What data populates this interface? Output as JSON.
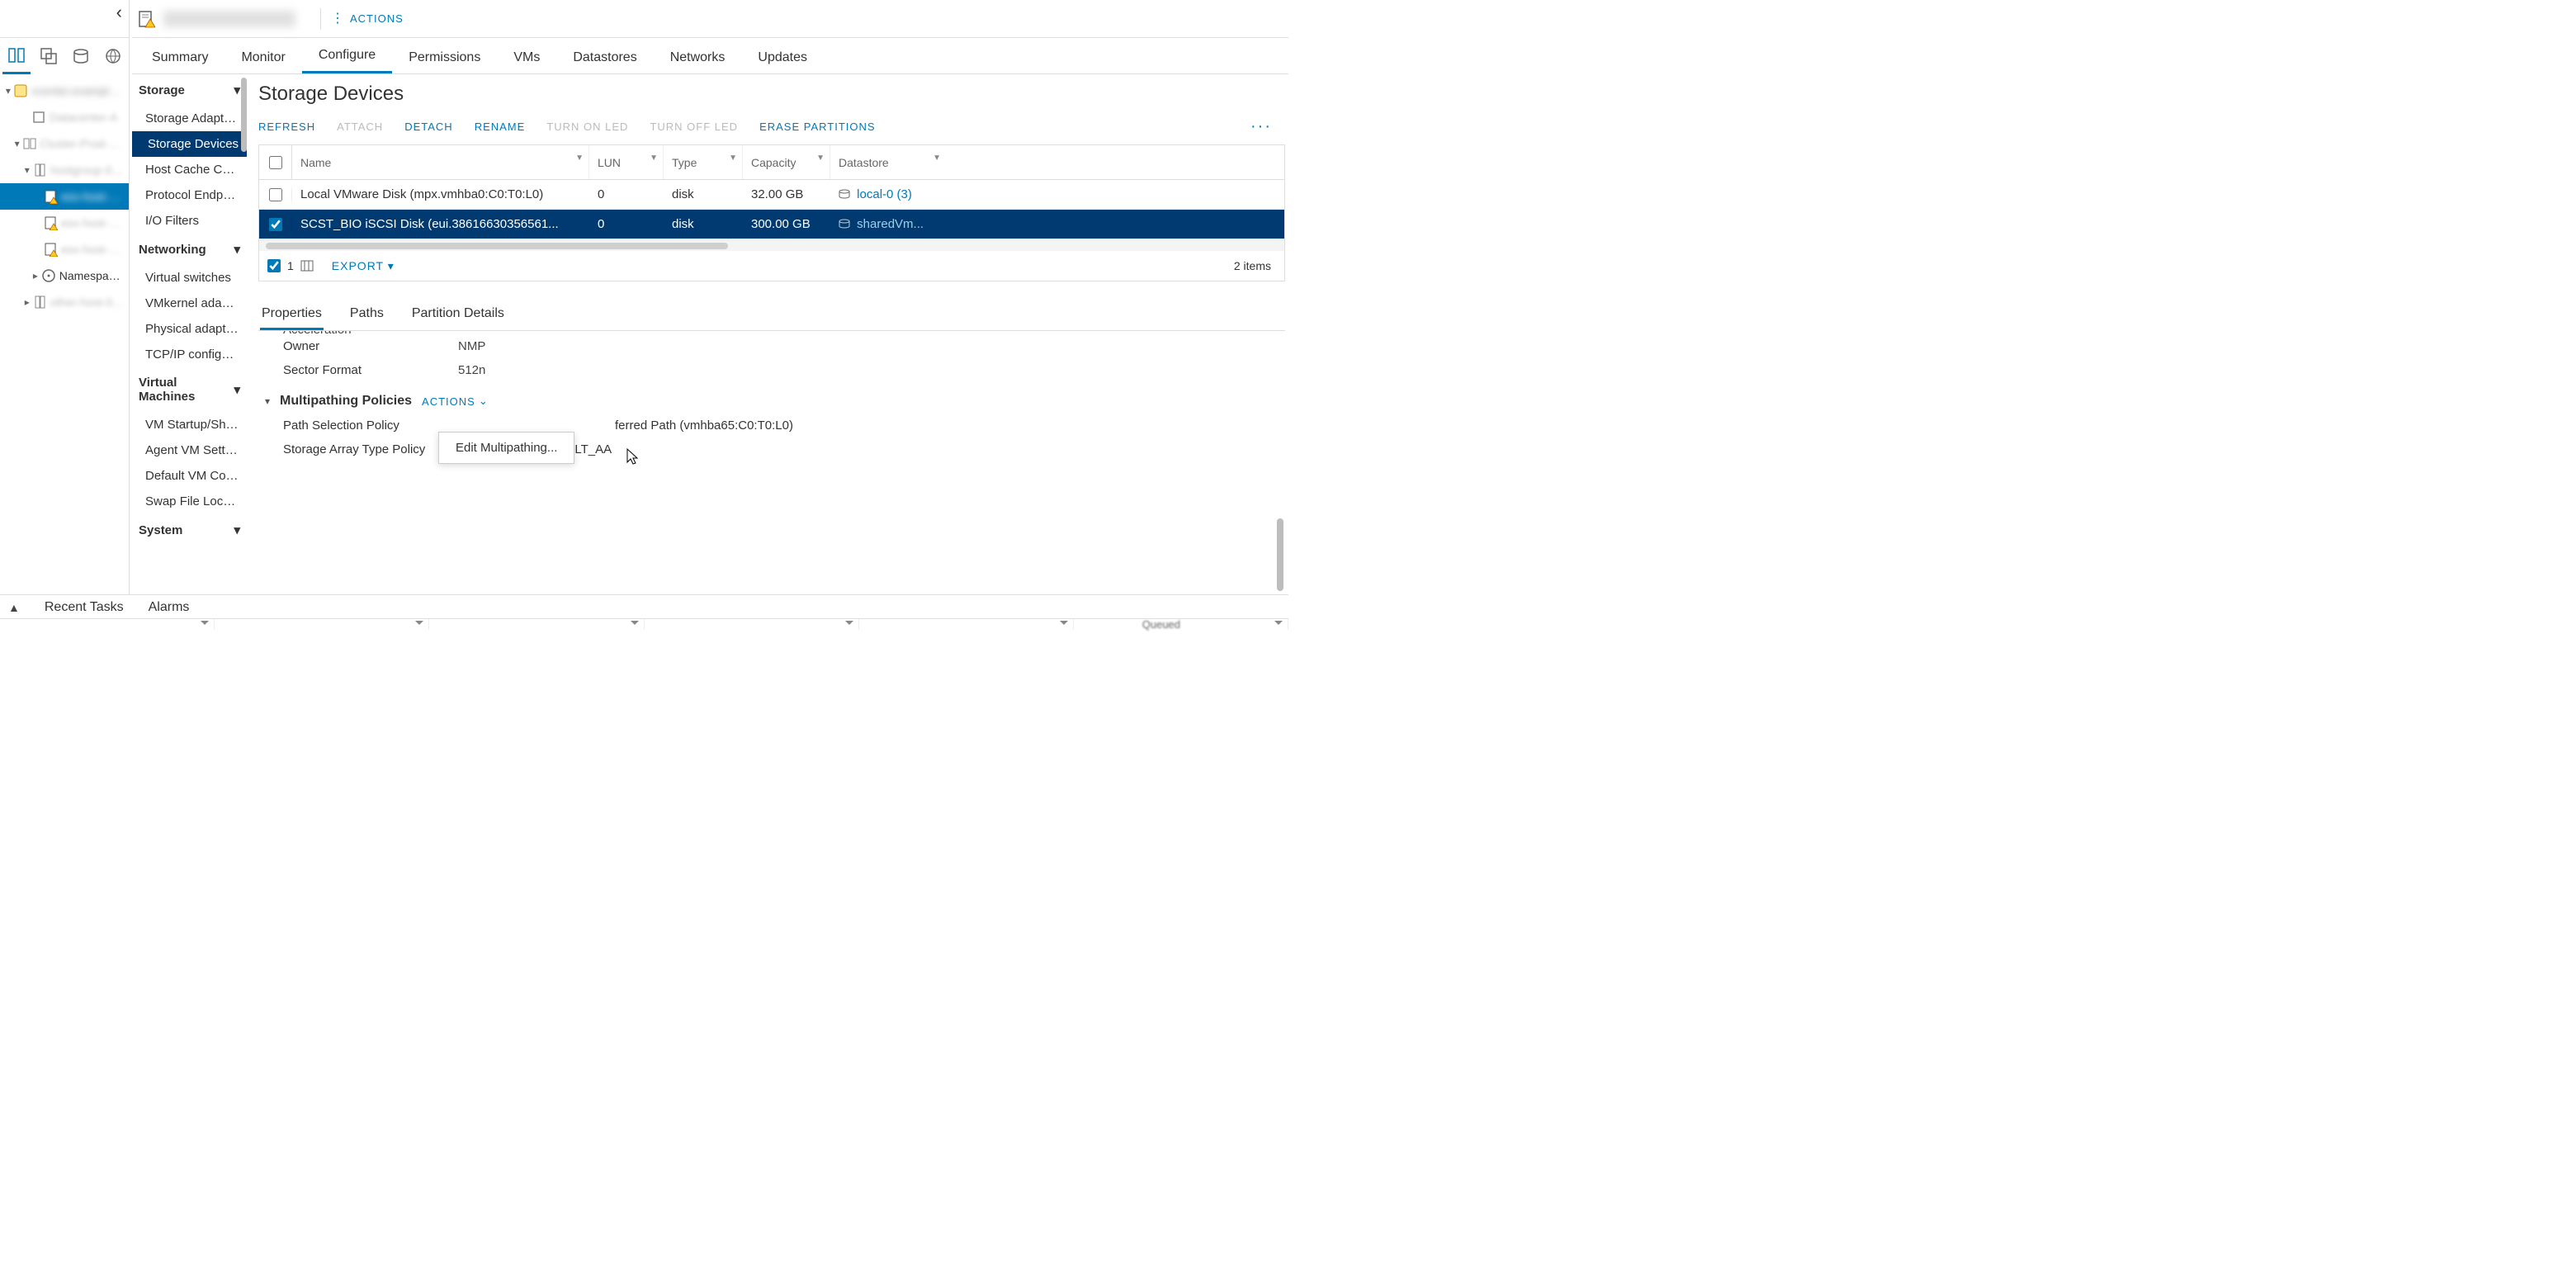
{
  "left_nav": {
    "tree": {
      "namespaces_label": "Namespaces"
    }
  },
  "header": {
    "actions_label": "ACTIONS",
    "tabs": [
      "Summary",
      "Monitor",
      "Configure",
      "Permissions",
      "VMs",
      "Datastores",
      "Networks",
      "Updates"
    ]
  },
  "config_sidebar": {
    "sections": [
      {
        "title": "Storage",
        "items": [
          "Storage Adapters",
          "Storage Devices",
          "Host Cache Configuration",
          "Protocol Endpoints",
          "I/O Filters"
        ]
      },
      {
        "title": "Networking",
        "items": [
          "Virtual switches",
          "VMkernel adapters",
          "Physical adapters",
          "TCP/IP configuration"
        ]
      },
      {
        "title": "Virtual Machines",
        "items": [
          "VM Startup/Shutdown",
          "Agent VM Settings",
          "Default VM Compatibility",
          "Swap File Location"
        ]
      },
      {
        "title": "System",
        "items": []
      }
    ],
    "selected": "Storage Devices"
  },
  "page": {
    "title": "Storage Devices",
    "toolbar": {
      "refresh": "REFRESH",
      "attach": "ATTACH",
      "detach": "DETACH",
      "rename": "RENAME",
      "turn_on_led": "TURN ON LED",
      "turn_off_led": "TURN OFF LED",
      "erase": "ERASE PARTITIONS"
    },
    "table": {
      "headers": {
        "name": "Name",
        "lun": "LUN",
        "type": "Type",
        "capacity": "Capacity",
        "datastore": "Datastore"
      },
      "rows": [
        {
          "selected": false,
          "name": "Local VMware Disk (mpx.vmhba0:C0:T0:L0)",
          "lun": "0",
          "type": "disk",
          "capacity": "32.00 GB",
          "datastore": "local-0 (3)"
        },
        {
          "selected": true,
          "name": "SCST_BIO iSCSI Disk (eui.38616630356561...",
          "lun": "0",
          "type": "disk",
          "capacity": "300.00 GB",
          "datastore": "sharedVm..."
        }
      ],
      "footer": {
        "selected_count": "1",
        "export": "EXPORT",
        "items": "2 items"
      }
    },
    "details": {
      "tabs": [
        "Properties",
        "Paths",
        "Partition Details"
      ],
      "acceleration_cut": "Acceleration",
      "owner_k": "Owner",
      "owner_v": "NMP",
      "sector_k": "Sector Format",
      "sector_v": "512n",
      "mp_title": "Multipathing Policies",
      "mp_actions": "ACTIONS",
      "dropdown_item": "Edit Multipathing...",
      "psp_k": "Path Selection Policy",
      "psp_v_tail": "ferred Path (vmhba65:C0:T0:L0)",
      "satp_k": "Storage Array Type Policy",
      "satp_v": "VMW_SATP_DEFAULT_AA"
    }
  },
  "bottom": {
    "recent_tasks": "Recent Tasks",
    "alarms": "Alarms",
    "queued": "Queued"
  }
}
